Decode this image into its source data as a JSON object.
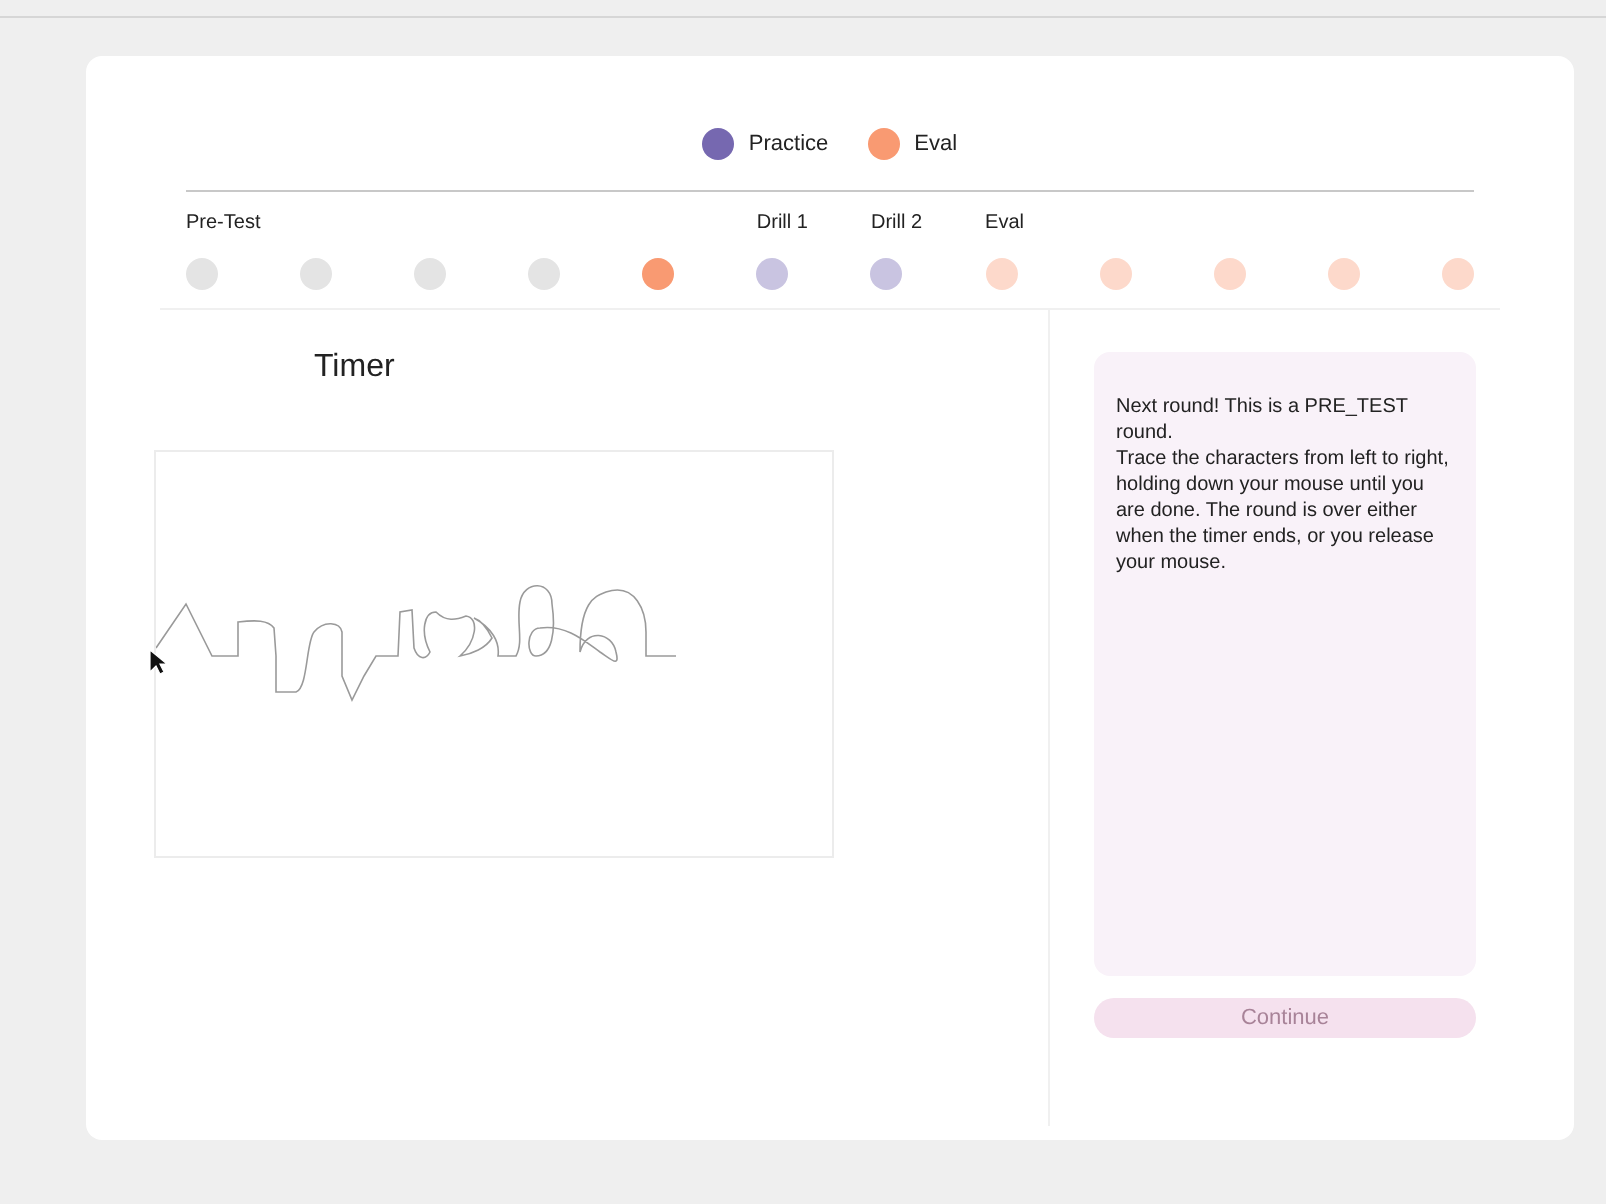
{
  "legend": [
    {
      "label": "Practice",
      "color": "#7668b0"
    },
    {
      "label": "Eval",
      "color": "#f99a72"
    }
  ],
  "rounds": [
    {
      "kind": "pretest",
      "label": "Pre-Test",
      "current": false
    },
    {
      "kind": "pretest",
      "current": false
    },
    {
      "kind": "pretest",
      "current": false
    },
    {
      "kind": "pretest",
      "current": false
    },
    {
      "kind": "pretest",
      "current": true
    },
    {
      "kind": "practice",
      "label": "Drill 1",
      "current": false
    },
    {
      "kind": "practice",
      "label": "Drill 2",
      "current": false
    },
    {
      "kind": "eval",
      "label": "Eval",
      "current": false
    },
    {
      "kind": "eval",
      "current": false
    },
    {
      "kind": "eval",
      "current": false
    },
    {
      "kind": "eval",
      "current": false
    },
    {
      "kind": "eval",
      "current": false
    }
  ],
  "timer": {
    "label": "Timer"
  },
  "instructions": [
    "Next round! This is a PRE_TEST round.",
    "Trace the characters from left to right, holding down your mouse until you are done. The round is over either when the timer ends, or you release your mouse."
  ],
  "continue_button": {
    "label": "Continue",
    "disabled": true
  }
}
